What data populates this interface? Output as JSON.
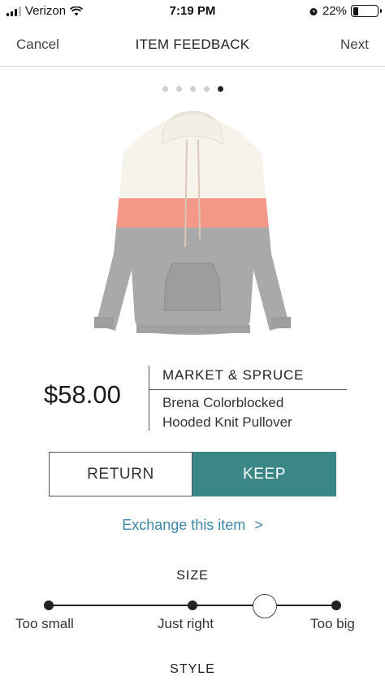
{
  "status_bar": {
    "carrier": "Verizon",
    "time": "7:19 PM",
    "battery": "22%",
    "battery_level": 0.22
  },
  "nav": {
    "cancel_label": "Cancel",
    "title": "ITEM FEEDBACK",
    "next_label": "Next"
  },
  "carousel": {
    "total": 5,
    "active_index": 4
  },
  "product": {
    "price": "$58.00",
    "brand": "MARKET & SPRUCE",
    "name_line1": "Brena Colorblocked",
    "name_line2": "Hooded Knit Pullover",
    "colors": {
      "top": "#f6f3ea",
      "stripe": "#f4988a",
      "bottom": "#a9a9a9"
    }
  },
  "actions": {
    "return_label": "RETURN",
    "keep_label": "KEEP",
    "keep_color": "#3b8787",
    "exchange_label": "Exchange this item",
    "exchange_chevron": ">"
  },
  "size": {
    "label": "SIZE",
    "options": [
      "Too small",
      "Just right",
      "Too big"
    ],
    "selected_position": "between Just right and Too big"
  },
  "style": {
    "label": "STYLE"
  }
}
